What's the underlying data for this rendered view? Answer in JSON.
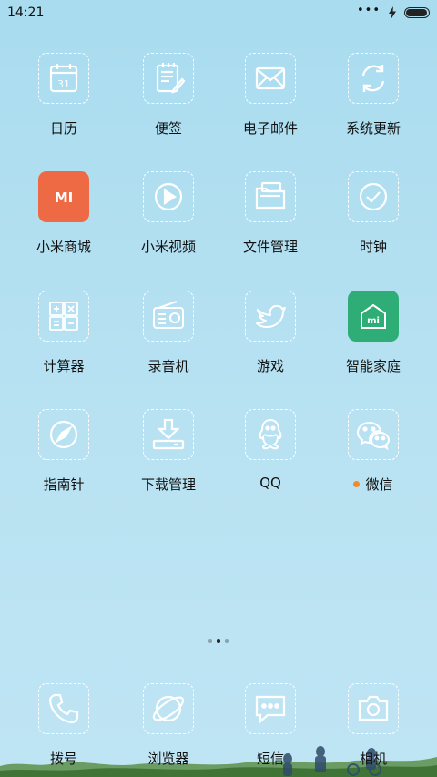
{
  "status_bar": {
    "time": "14:21",
    "dots": "•••",
    "battery_level": 0.95
  },
  "apps": [
    {
      "label": "日历",
      "icon": "calendar-icon",
      "date": "31"
    },
    {
      "label": "便签",
      "icon": "notepad-icon"
    },
    {
      "label": "电子邮件",
      "icon": "email-icon"
    },
    {
      "label": "系统更新",
      "icon": "update-icon"
    },
    {
      "label": "小米商城",
      "icon": "mi-store-icon",
      "badge_text": "MI"
    },
    {
      "label": "小米视频",
      "icon": "video-play-icon"
    },
    {
      "label": "文件管理",
      "icon": "folder-icon"
    },
    {
      "label": "时钟",
      "icon": "clock-icon"
    },
    {
      "label": "计算器",
      "icon": "calculator-icon"
    },
    {
      "label": "录音机",
      "icon": "radio-icon"
    },
    {
      "label": "游戏",
      "icon": "bird-icon"
    },
    {
      "label": "智能家庭",
      "icon": "smart-home-icon",
      "badge_text": "mi"
    },
    {
      "label": "指南针",
      "icon": "compass-icon"
    },
    {
      "label": "下载管理",
      "icon": "download-icon"
    },
    {
      "label": "QQ",
      "icon": "qq-penguin-icon"
    },
    {
      "label": "微信",
      "icon": "wechat-icon",
      "notification": true
    }
  ],
  "page_indicator": {
    "pages": 3,
    "active": 1
  },
  "dock": [
    {
      "label": "拨号",
      "icon": "phone-icon"
    },
    {
      "label": "浏览器",
      "icon": "browser-icon"
    },
    {
      "label": "短信",
      "icon": "message-icon"
    },
    {
      "label": "相机",
      "icon": "camera-icon"
    }
  ],
  "colors": {
    "background": "#b3e0f1",
    "mi_store": "#ee6a45",
    "smart_home": "#2fad77",
    "notification_dot": "#f08a2c",
    "icon_outline": "#ffffff"
  }
}
